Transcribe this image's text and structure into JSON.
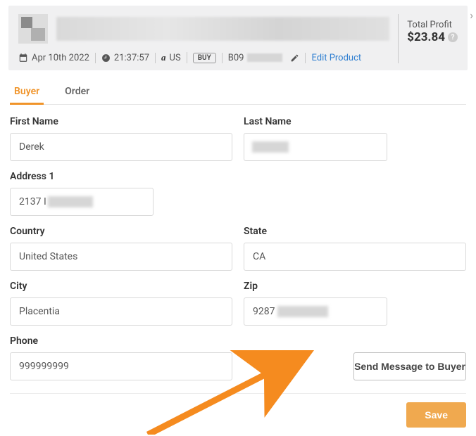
{
  "header": {
    "date": "Apr 10th 2022",
    "time": "21:37:57",
    "marketplace": "US",
    "buy_badge": "BUY",
    "asin_prefix": "B09",
    "edit_label": "Edit Product",
    "profit_label": "Total Profit",
    "profit_value": "$23.84"
  },
  "tabs": {
    "buyer": "Buyer",
    "order": "Order"
  },
  "form": {
    "first_name_label": "First Name",
    "first_name": "Derek",
    "last_name_label": "Last Name",
    "last_name": "",
    "address1_label": "Address 1",
    "address1": "2137 I",
    "country_label": "Country",
    "country": "United States",
    "state_label": "State",
    "state": "CA",
    "city_label": "City",
    "city": "Placentia",
    "zip_label": "Zip",
    "zip": "9287",
    "phone_label": "Phone",
    "phone": "999999999",
    "send_message_label": "Send Message to Buyer"
  },
  "footer": {
    "save_label": "Save"
  }
}
